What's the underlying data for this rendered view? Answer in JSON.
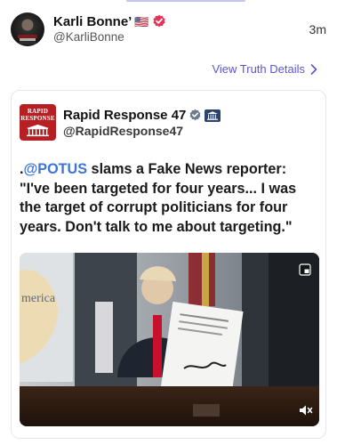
{
  "post": {
    "author_name": "Karli Bonne’",
    "flag": "🇺🇸",
    "author_handle": "@KarliBonne",
    "time": "3m",
    "details_link": "View Truth Details"
  },
  "quoted": {
    "avatar_text": "RAPID RESPONSE",
    "author_name": "Rapid Response 47",
    "author_handle": "@RapidResponse47",
    "text_prefix": ".",
    "mention": "@POTUS",
    "text_body": " slams a Fake News reporter: \"I've been targeted for four years... I was the target of corrupt politicians for four years. Don't talk to me about targeting.\"",
    "video": {
      "caption": "merica"
    }
  },
  "colors": {
    "link": "#5b55cf",
    "mention": "#3d74d6",
    "verified_badge": "#e8325a",
    "rr_avatar": "#b81f22"
  }
}
